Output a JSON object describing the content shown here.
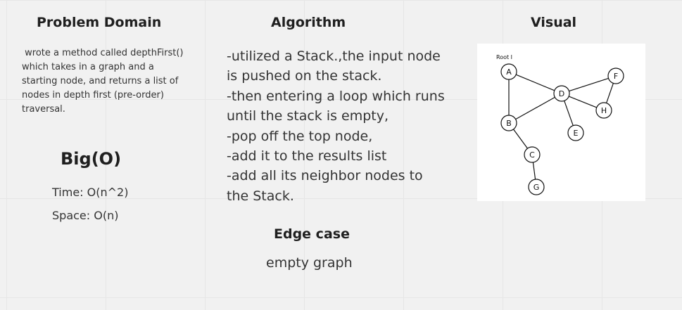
{
  "columns": {
    "problem_domain": {
      "heading": "Problem Domain",
      "description": " wrote a method called depthFirst() which takes in a graph and a starting node, and returns a list of nodes in depth first (pre-order) traversal.",
      "bigo_title": "Big(O)",
      "time": "Time: O(n^2)",
      "space": "Space: O(n)"
    },
    "algorithm": {
      "heading": "Algorithm",
      "steps": [
        "-utilized a Stack.,the input node is pushed on the stack.",
        "-then entering a loop which runs until the stack is empty,",
        "-pop off the top node,",
        "-add it to the results list",
        "-add all its neighbor nodes to the Stack."
      ],
      "edge_case_heading": "Edge case",
      "edge_case": "empty graph"
    },
    "visual": {
      "heading": "Visual",
      "root_label": "Root I",
      "nodes": [
        {
          "id": "A"
        },
        {
          "id": "B"
        },
        {
          "id": "C"
        },
        {
          "id": "D"
        },
        {
          "id": "E"
        },
        {
          "id": "F"
        },
        {
          "id": "G"
        },
        {
          "id": "H"
        }
      ],
      "edges": [
        [
          "A",
          "B"
        ],
        [
          "A",
          "D"
        ],
        [
          "B",
          "D"
        ],
        [
          "B",
          "C"
        ],
        [
          "C",
          "G"
        ],
        [
          "D",
          "E"
        ],
        [
          "D",
          "F"
        ],
        [
          "D",
          "H"
        ],
        [
          "F",
          "H"
        ]
      ]
    }
  }
}
